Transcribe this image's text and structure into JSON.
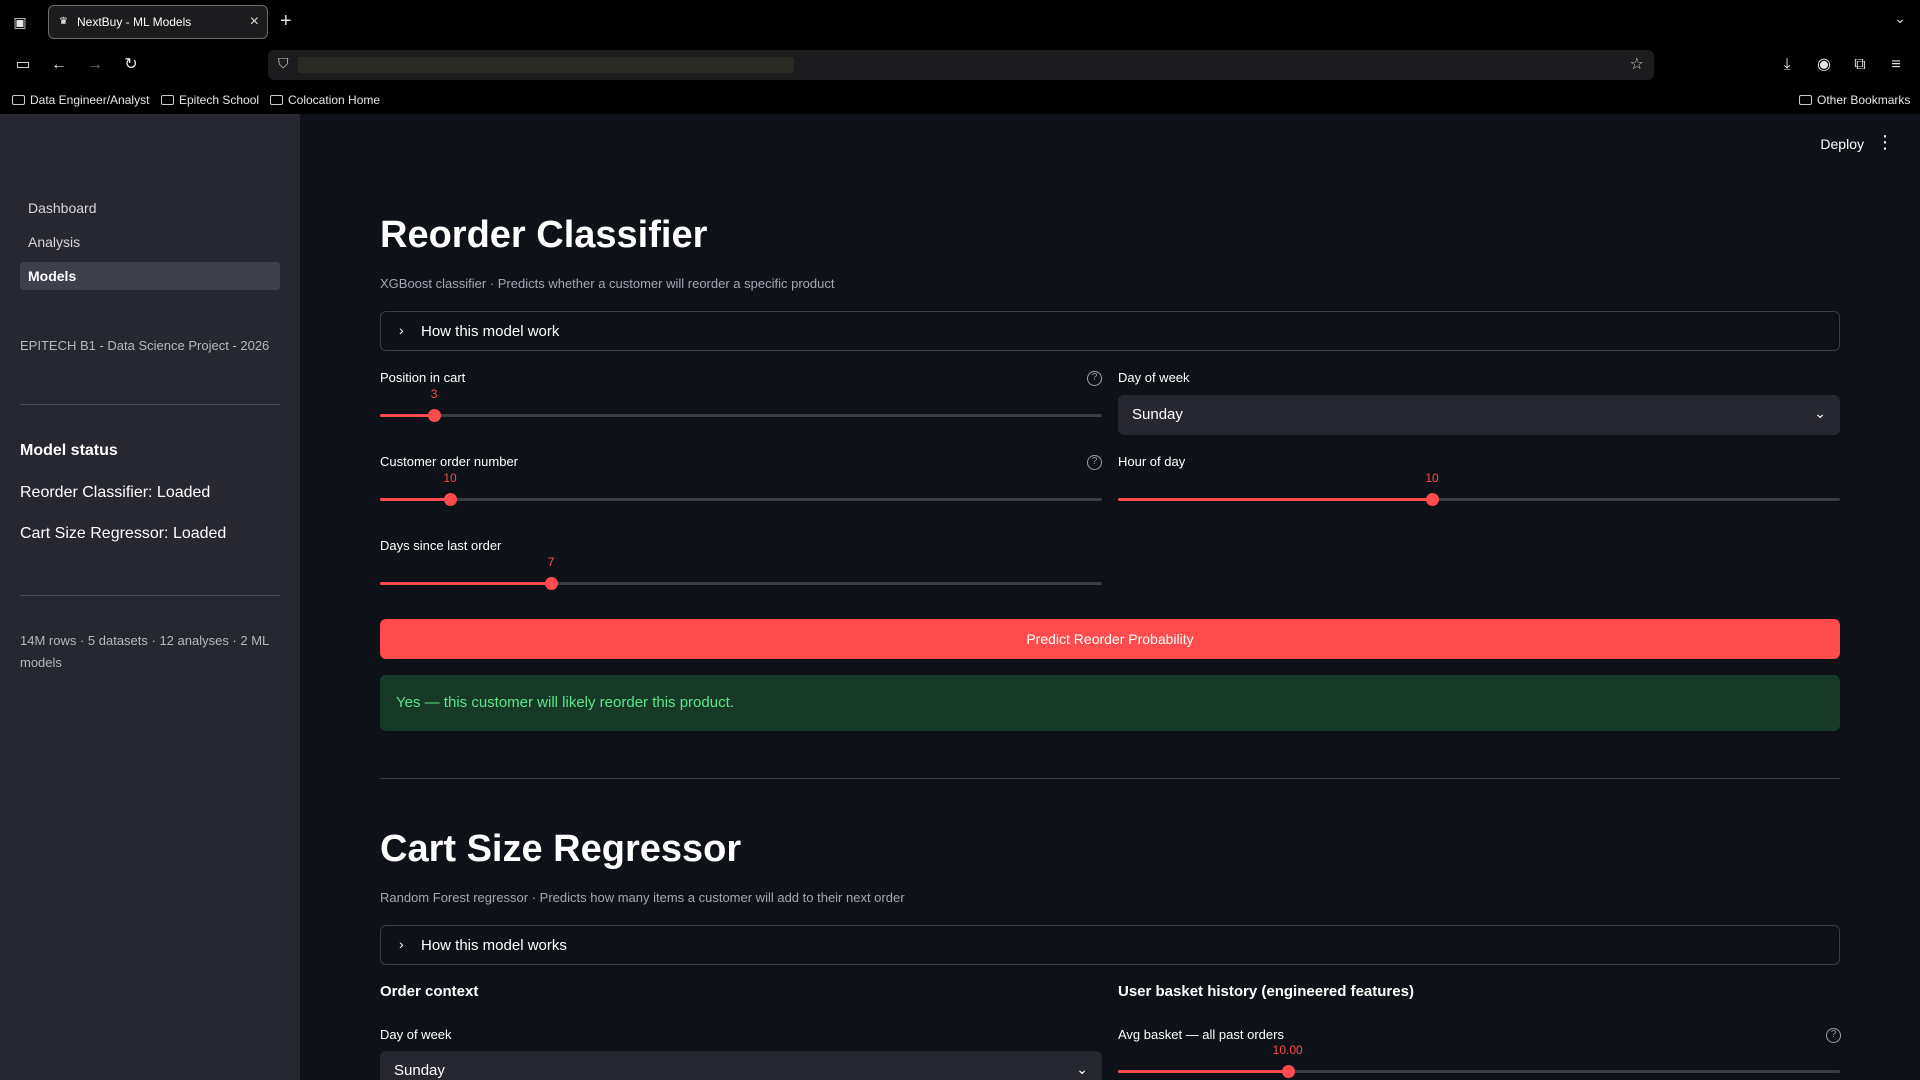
{
  "browser": {
    "tab_title": "NextBuy - ML Models",
    "bookmarks": [
      "Data Engineer/Analyst",
      "Epitech School",
      "Colocation Home"
    ],
    "other_bookmarks": "Other Bookmarks"
  },
  "sidebar": {
    "nav": [
      "Dashboard",
      "Analysis",
      "Models"
    ],
    "active": "Models",
    "project": "EPITECH B1 - Data Science Project - 2026",
    "status_heading": "Model status",
    "statuses": [
      "Reorder Classifier: Loaded",
      "Cart Size Regressor: Loaded"
    ],
    "footer": "14M rows · 5 datasets · 12 analyses · 2 ML models"
  },
  "header": {
    "deploy": "Deploy"
  },
  "reorder": {
    "title": "Reorder Classifier",
    "caption": "XGBoost classifier · Predicts whether a customer will reorder a specific product",
    "expander": "How this model work",
    "position_label": "Position in cart",
    "position_value": "3",
    "day_label": "Day of week",
    "day_value": "Sunday",
    "order_number_label": "Customer order number",
    "order_number_value": "10",
    "hour_label": "Hour of day",
    "hour_value": "10",
    "days_since_label": "Days since last order",
    "days_since_value": "7",
    "button": "Predict Reorder Probability",
    "result": "Yes — this customer will likely reorder this product."
  },
  "sliders": {
    "position": 0.075,
    "order_number": 0.097,
    "hour": 0.435,
    "days_since": 0.237,
    "avg_basket": 0.235
  },
  "cartsize": {
    "title": "Cart Size Regressor",
    "caption": "Random Forest regressor · Predicts how many items a customer will add to their next order",
    "expander": "How this model works",
    "order_context": "Order context",
    "history": "User basket history (engineered features)",
    "day_label": "Day of week",
    "day_value": "Sunday",
    "avg_basket_label": "Avg basket — all past orders",
    "avg_basket_value": "10.00"
  }
}
